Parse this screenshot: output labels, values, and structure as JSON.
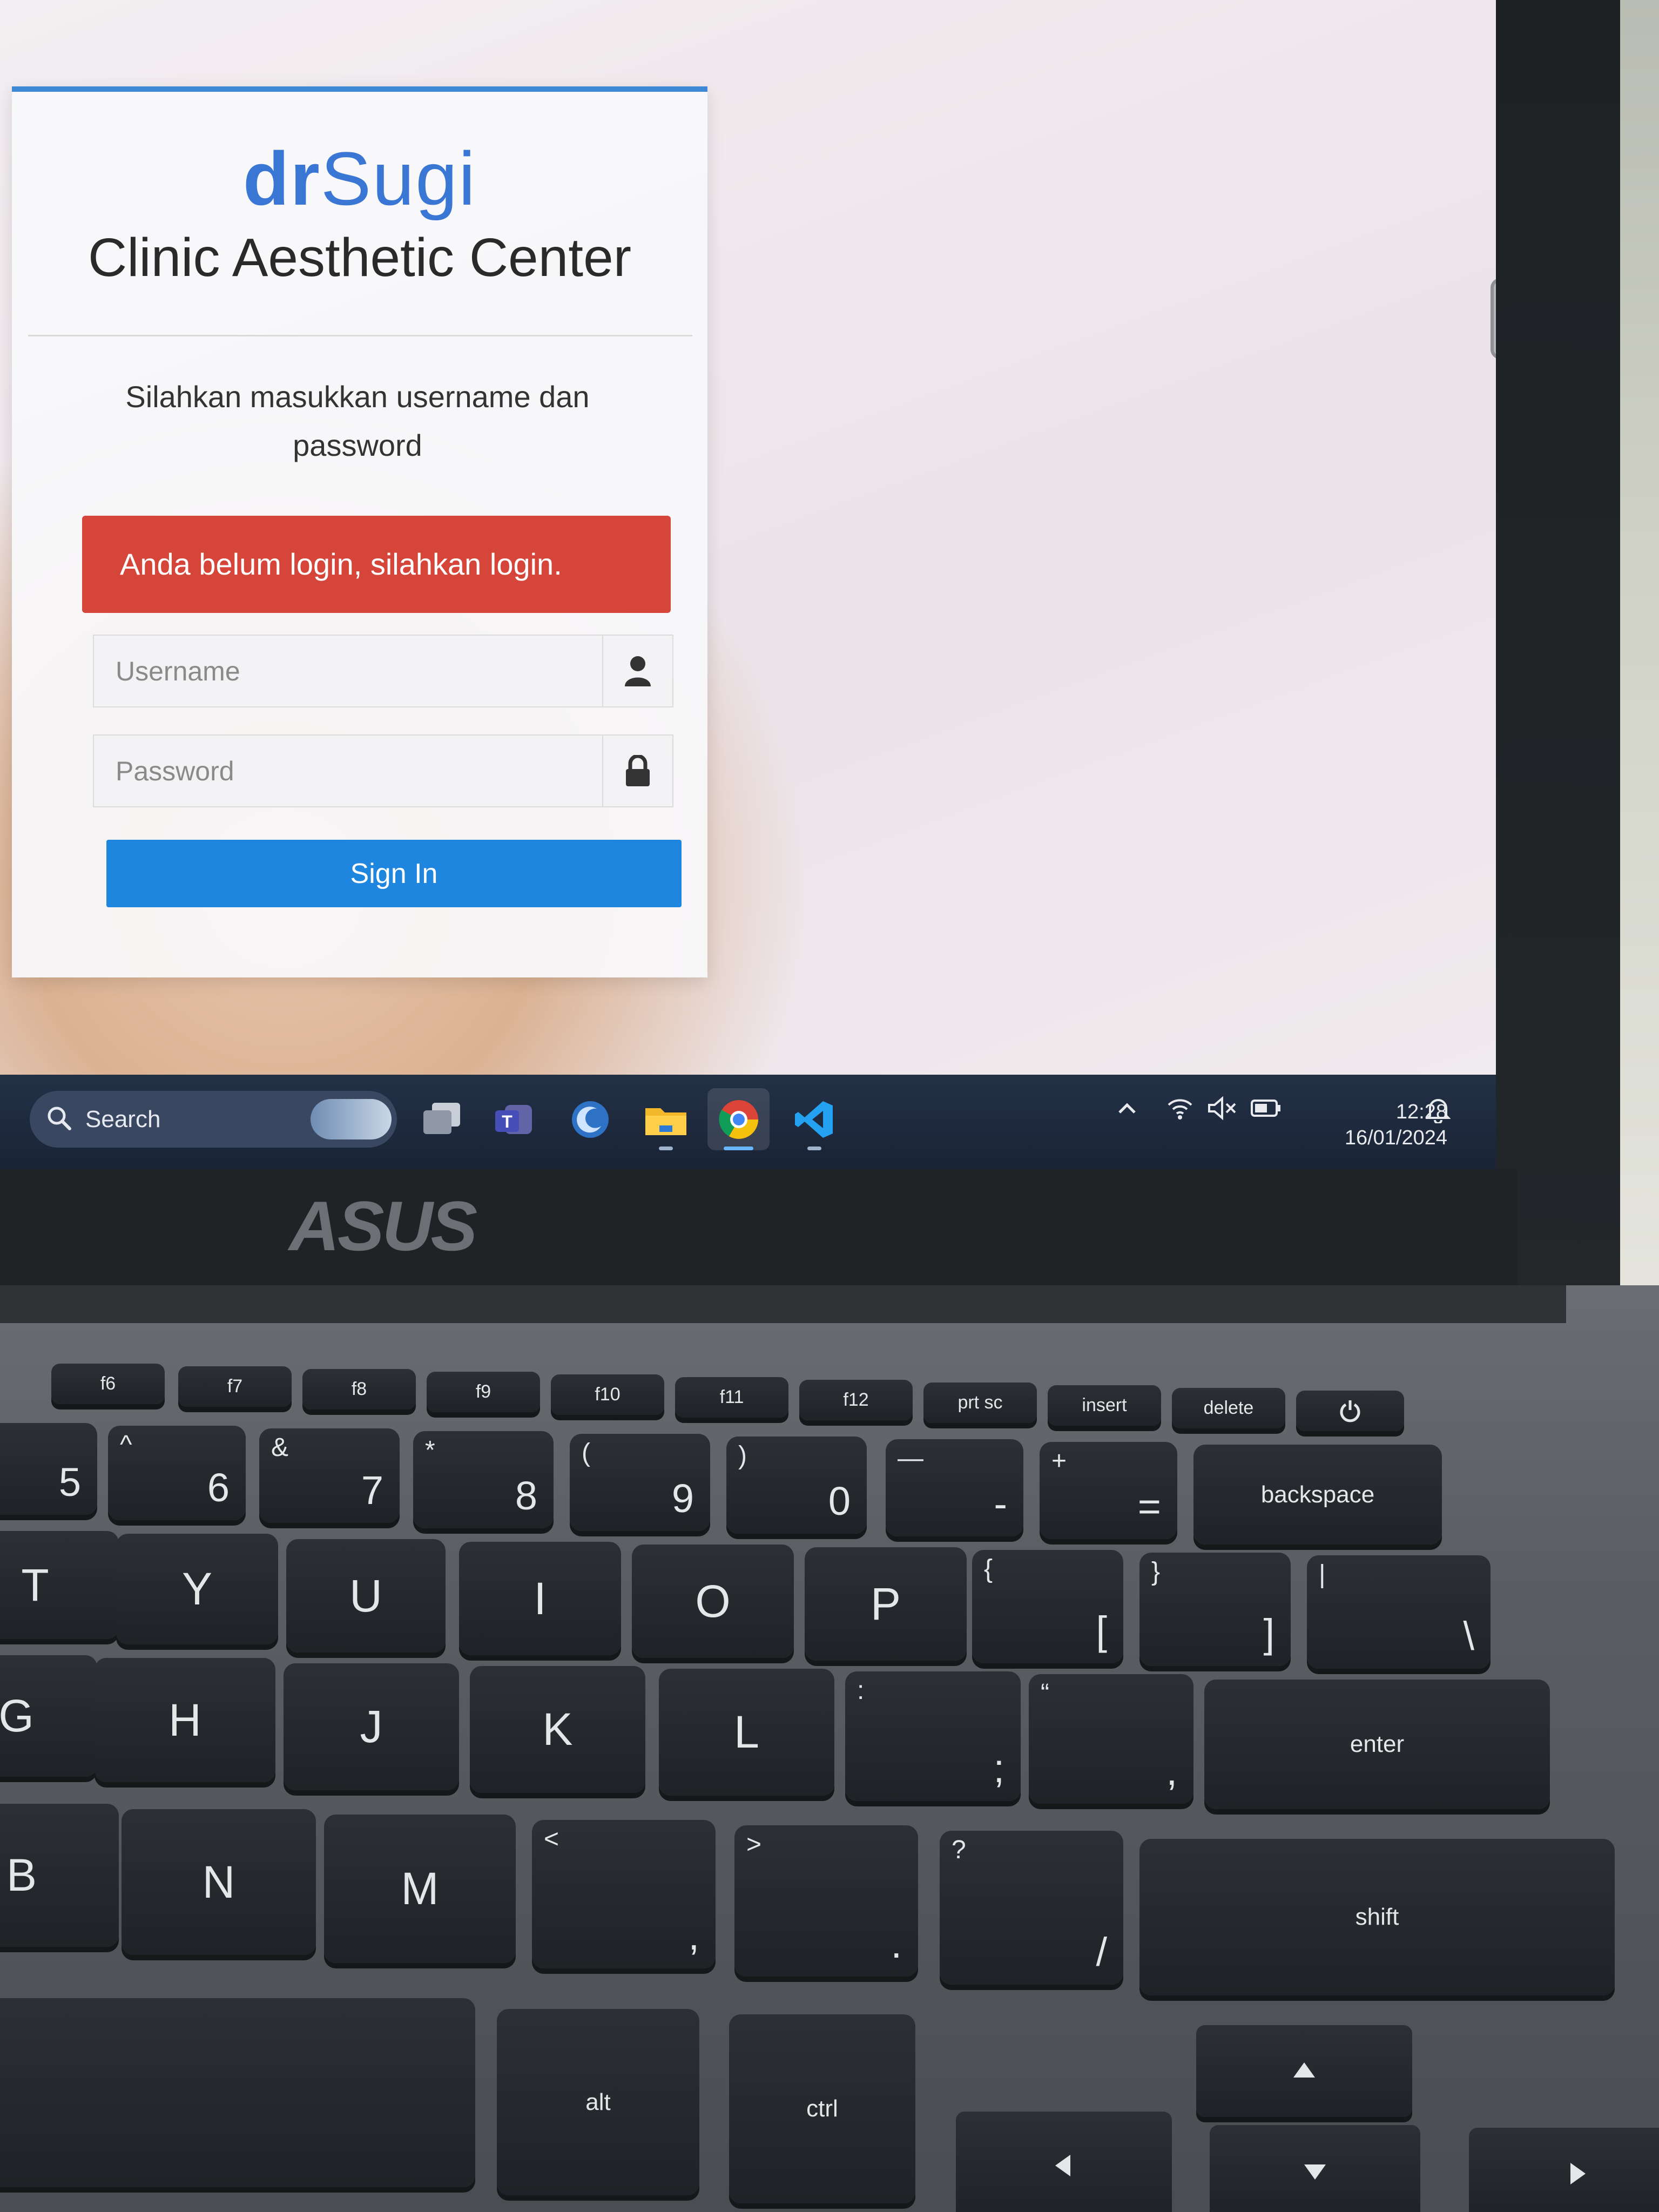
{
  "brand": {
    "prefix": "dr",
    "suffix": "Sugi"
  },
  "clinic_name": "Clinic Aesthetic Center",
  "login_message": "Silahkan masukkan username dan password",
  "alert": "Anda belum login, silahkan login.",
  "username": {
    "placeholder": "Username",
    "icon": "user-icon"
  },
  "password": {
    "placeholder": "Password",
    "icon": "lock-icon"
  },
  "signin_label": "Sign In",
  "colors": {
    "brand": "#3a77d4",
    "alert": "#d6453a",
    "button": "#1f86df"
  },
  "taskbar": {
    "search_label": "Search",
    "apps": [
      "task-view",
      "teams",
      "edge-like",
      "file-explorer",
      "chrome",
      "vscode"
    ],
    "time": "12:28",
    "date": "16/01/2024"
  },
  "laptop_brand": "ASUS",
  "keyboard": {
    "fn_row": [
      "f6",
      "f7",
      "f8",
      "f9",
      "f10",
      "f11",
      "f12",
      "prt sc",
      "insert",
      "delete"
    ],
    "num_row": [
      {
        "top": "",
        "main": "5"
      },
      {
        "top": "^",
        "main": "6"
      },
      {
        "top": "&",
        "main": "7"
      },
      {
        "top": "*",
        "main": "8"
      },
      {
        "top": "(",
        "main": "9"
      },
      {
        "top": ")",
        "main": "0"
      },
      {
        "top": "—",
        "main": "-"
      },
      {
        "top": "+",
        "main": "="
      }
    ],
    "backspace": "backspace",
    "row2": [
      "T",
      "Y",
      "U",
      "I",
      "O",
      "P"
    ],
    "row2_sym": [
      {
        "top": "{",
        "main": "["
      },
      {
        "top": "}",
        "main": "]"
      },
      {
        "top": "|",
        "main": "\\"
      }
    ],
    "row3": [
      "G",
      "H",
      "J",
      "K",
      "L"
    ],
    "row3_sym": [
      {
        "top": ":",
        "main": ";"
      },
      {
        "top": "“",
        "main": ","
      }
    ],
    "enter": "enter",
    "row4": [
      "B",
      "N",
      "M"
    ],
    "row4_sym": [
      {
        "top": "<",
        "main": ","
      },
      {
        "top": ">",
        "main": "."
      },
      {
        "top": "?",
        "main": "/"
      }
    ],
    "shift": "shift",
    "alt": "alt",
    "ctrl": "ctrl"
  }
}
